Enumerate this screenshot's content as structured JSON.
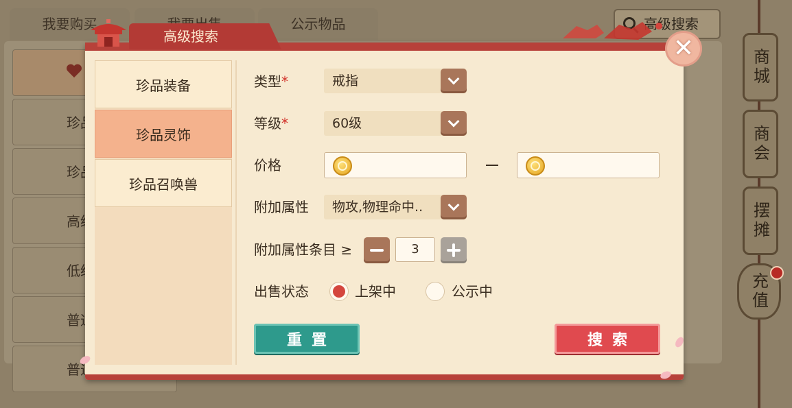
{
  "background": {
    "tabs": [
      "我要购买",
      "我要出售",
      "公示物品"
    ],
    "search_button": "高级搜索",
    "list_items": [
      "",
      "珍品",
      "珍品",
      "高级",
      "低级",
      "普通",
      "普通"
    ],
    "side_nav": [
      "商城",
      "商会",
      "摆摊",
      "充值"
    ]
  },
  "dialog": {
    "title": "高级搜索",
    "categories": [
      "珍品装备",
      "珍品灵饰",
      "珍品召唤兽"
    ],
    "active_category": "珍品灵饰",
    "form": {
      "type_label": "类型",
      "type_value": "戒指",
      "level_label": "等级",
      "level_value": "60级",
      "required_mark": "*",
      "price_label": "价格",
      "price_separator": "—",
      "attr_label": "附加属性",
      "attr_value": "物攻,物理命中..",
      "attr_count_label": "附加属性条目 ≥",
      "attr_count_value": "3",
      "status_label": "出售状态",
      "status_options": [
        "上架中",
        "公示中"
      ],
      "status_selected": "上架中"
    },
    "reset_button": "重置",
    "search_button": "搜索"
  },
  "colors": {
    "accent_red": "#b7413a",
    "active_category": "#f4b28d",
    "reset_teal": "#2e9a8c",
    "search_red": "#e04a4f"
  }
}
